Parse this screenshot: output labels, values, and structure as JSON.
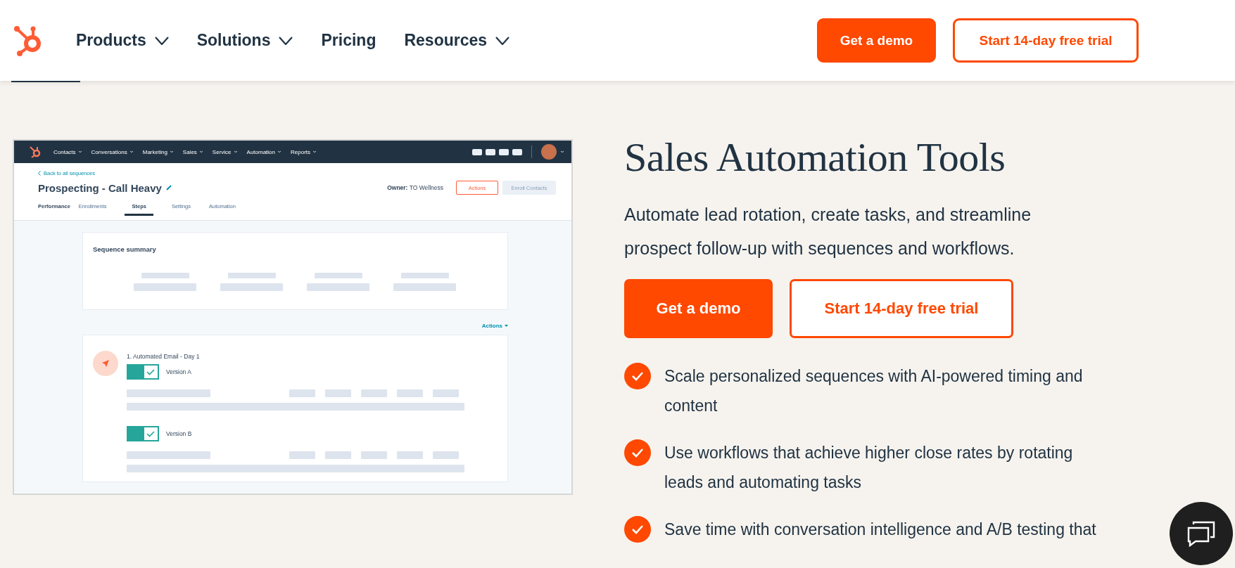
{
  "header": {
    "nav": [
      {
        "label": "Products",
        "has_menu": true
      },
      {
        "label": "Solutions",
        "has_menu": true
      },
      {
        "label": "Pricing",
        "has_menu": false
      },
      {
        "label": "Resources",
        "has_menu": true
      }
    ],
    "buttons": [
      {
        "label": "Get a demo",
        "kind": "primary"
      },
      {
        "label": "Start 14-day free trial",
        "kind": "secondary"
      }
    ]
  },
  "app_screenshot": {
    "nav": [
      {
        "label": "Contacts",
        "has_menu": true
      },
      {
        "label": "Conversations",
        "has_menu": true
      },
      {
        "label": "Marketing",
        "has_menu": true
      },
      {
        "label": "Sales",
        "has_menu": true
      },
      {
        "label": "Service",
        "has_menu": true
      },
      {
        "label": "Automation",
        "has_menu": true
      },
      {
        "label": "Reports",
        "has_menu": true
      }
    ],
    "back_link": "Back to all sequences",
    "title": "Prospecting - Call Heavy",
    "owner": "**Owner:** TO Wellness",
    "header_buttons": [
      {
        "label": "Actions",
        "kind": "outline",
        "disabled": false
      },
      {
        "label": "Enroll Contacts",
        "kind": "solid",
        "disabled": true
      }
    ],
    "tabs": [
      {
        "label": "Performance",
        "selected": false
      },
      {
        "label": "Enrollments",
        "selected": false
      },
      {
        "label": "Steps",
        "selected": true
      },
      {
        "label": "Settings",
        "selected": false
      },
      {
        "label": "Automation",
        "selected": false
      }
    ],
    "summary_title": "Sequence summary",
    "actions_link": "Actions",
    "step": {
      "title": "1. Automated Email - Day 1",
      "versions": [
        {
          "label": "Version A",
          "on": true
        },
        {
          "label": "Version B",
          "on": true
        }
      ]
    }
  },
  "hero": {
    "title": "Sales Automation Tools",
    "description": "Automate lead rotation, create tasks, and streamline prospect follow-up with sequences and workflows.",
    "buttons": [
      {
        "label": "Get a demo",
        "kind": "primary"
      },
      {
        "label": "Start 14-day free trial",
        "kind": "secondary"
      }
    ],
    "features": [
      "Scale personalized sequences with AI-powered timing and content",
      "Use workflows that achieve higher close rates by rotating leads and automating tasks",
      "Save time with conversation intelligence and A/B testing that"
    ]
  }
}
